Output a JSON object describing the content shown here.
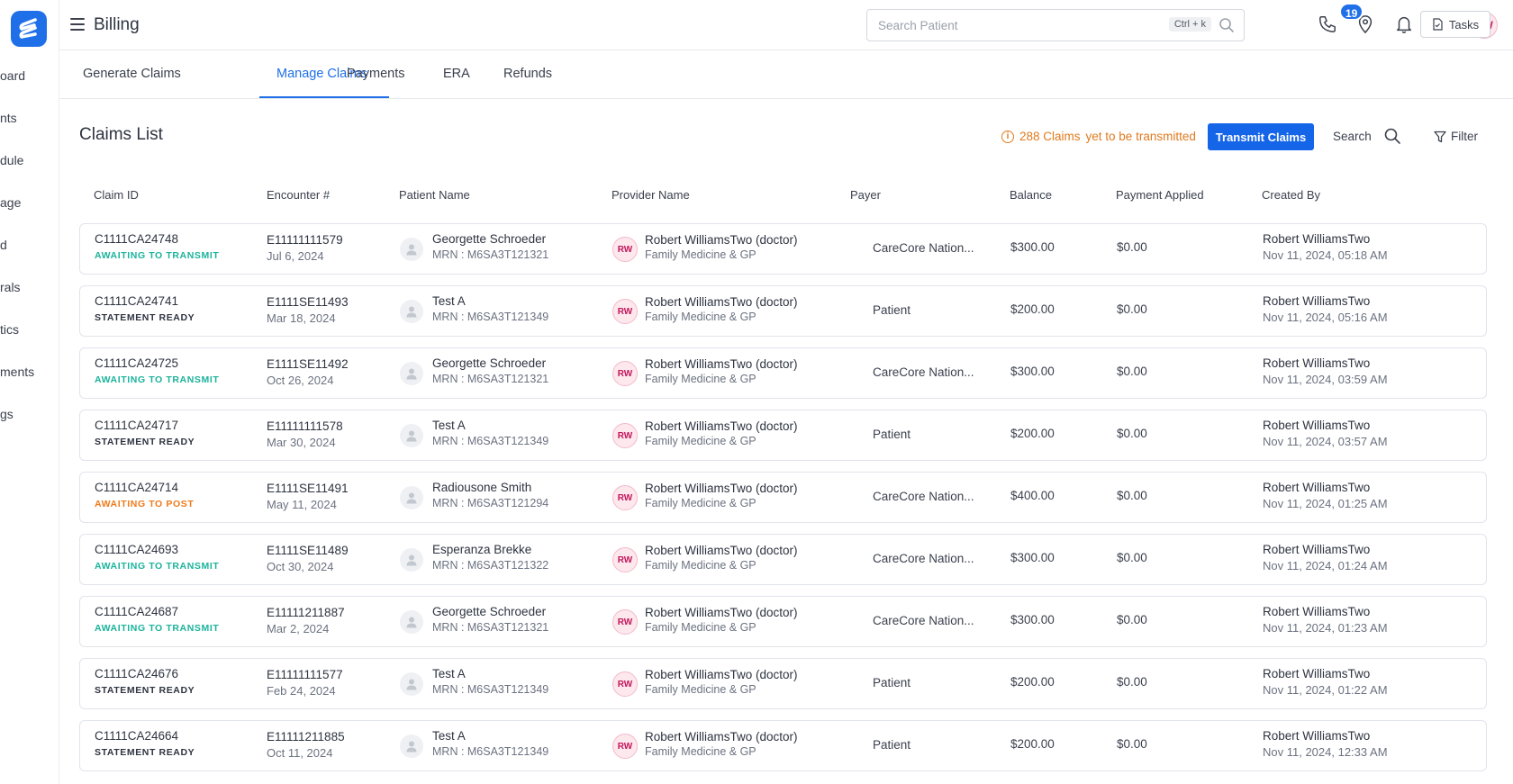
{
  "sidebar": {
    "items": [
      {
        "label": "oard"
      },
      {
        "label": "nts"
      },
      {
        "label": "dule"
      },
      {
        "label": "age"
      },
      {
        "label": "d"
      },
      {
        "label": "rals"
      },
      {
        "label": "tics"
      },
      {
        "label": "ments"
      },
      {
        "label": "gs"
      }
    ]
  },
  "header": {
    "title": "Billing",
    "search_placeholder": "Search Patient",
    "search_shortcut": "Ctrl + k",
    "notification_count": "19",
    "user_initials": "RW",
    "help_label": "?"
  },
  "tabs": [
    {
      "label": "Generate Claims",
      "active": false
    },
    {
      "label": "Manage Claims",
      "active": true
    },
    {
      "label": "Payments",
      "active": false
    },
    {
      "label": "ERA",
      "active": false
    },
    {
      "label": "Refunds",
      "active": false
    }
  ],
  "tasks_label": "Tasks",
  "claims": {
    "title": "Claims List",
    "pending_count": "288 Claims",
    "pending_text": "yet to be transmitted",
    "transmit_label": "Transmit Claims",
    "search_label": "Search",
    "filter_label": "Filter",
    "columns": [
      "Claim ID",
      "Encounter #",
      "Patient Name",
      "Provider Name",
      "Payer",
      "Balance",
      "Payment Applied",
      "Created By"
    ],
    "status_colors": {
      "awaiting_transmit": "#1bb39b",
      "statement_ready": "#2d3340",
      "awaiting_post": "#f07a1a"
    },
    "rows": [
      {
        "claim_id": "C1111CA24748",
        "status": "AWAITING TO TRANSMIT",
        "status_type": "awaiting_transmit",
        "encounter": "E11111111579",
        "encounter_date": "Jul 6, 2024",
        "patient": "Georgette Schroeder",
        "mrn": "MRN : M6SA3T121321",
        "provider_initials": "RW",
        "provider": "Robert WilliamsTwo (doctor)",
        "specialty": "Family Medicine & GP",
        "payer": "CareCore Nation...",
        "balance": "$300.00",
        "payment": "$0.00",
        "created_by": "Robert WilliamsTwo",
        "created_at": "Nov 11, 2024, 05:18 AM"
      },
      {
        "claim_id": "C1111CA24741",
        "status": "STATEMENT READY",
        "status_type": "statement_ready",
        "encounter": "E1111SE11493",
        "encounter_date": "Mar 18, 2024",
        "patient": "Test A",
        "mrn": "MRN : M6SA3T121349",
        "provider_initials": "RW",
        "provider": "Robert WilliamsTwo (doctor)",
        "specialty": "Family Medicine & GP",
        "payer": "Patient",
        "balance": "$200.00",
        "payment": "$0.00",
        "created_by": "Robert WilliamsTwo",
        "created_at": "Nov 11, 2024, 05:16 AM"
      },
      {
        "claim_id": "C1111CA24725",
        "status": "AWAITING TO TRANSMIT",
        "status_type": "awaiting_transmit",
        "encounter": "E1111SE11492",
        "encounter_date": "Oct 26, 2024",
        "patient": "Georgette Schroeder",
        "mrn": "MRN : M6SA3T121321",
        "provider_initials": "RW",
        "provider": "Robert WilliamsTwo (doctor)",
        "specialty": "Family Medicine & GP",
        "payer": "CareCore Nation...",
        "balance": "$300.00",
        "payment": "$0.00",
        "created_by": "Robert WilliamsTwo",
        "created_at": "Nov 11, 2024, 03:59 AM"
      },
      {
        "claim_id": "C1111CA24717",
        "status": "STATEMENT READY",
        "status_type": "statement_ready",
        "encounter": "E11111111578",
        "encounter_date": "Mar 30, 2024",
        "patient": "Test A",
        "mrn": "MRN : M6SA3T121349",
        "provider_initials": "RW",
        "provider": "Robert WilliamsTwo (doctor)",
        "specialty": "Family Medicine & GP",
        "payer": "Patient",
        "balance": "$200.00",
        "payment": "$0.00",
        "created_by": "Robert WilliamsTwo",
        "created_at": "Nov 11, 2024, 03:57 AM"
      },
      {
        "claim_id": "C1111CA24714",
        "status": "AWAITING TO POST",
        "status_type": "awaiting_post",
        "encounter": "E1111SE11491",
        "encounter_date": "May 11, 2024",
        "patient": "Radiousone Smith",
        "mrn": "MRN : M6SA3T121294",
        "provider_initials": "RW",
        "provider": "Robert WilliamsTwo (doctor)",
        "specialty": "Family Medicine & GP",
        "payer": "CareCore Nation...",
        "balance": "$400.00",
        "payment": "$0.00",
        "created_by": "Robert WilliamsTwo",
        "created_at": "Nov 11, 2024, 01:25 AM"
      },
      {
        "claim_id": "C1111CA24693",
        "status": "AWAITING TO TRANSMIT",
        "status_type": "awaiting_transmit",
        "encounter": "E1111SE11489",
        "encounter_date": "Oct 30, 2024",
        "patient": "Esperanza Brekke",
        "mrn": "MRN : M6SA3T121322",
        "provider_initials": "RW",
        "provider": "Robert WilliamsTwo (doctor)",
        "specialty": "Family Medicine & GP",
        "payer": "CareCore Nation...",
        "balance": "$300.00",
        "payment": "$0.00",
        "created_by": "Robert WilliamsTwo",
        "created_at": "Nov 11, 2024, 01:24 AM"
      },
      {
        "claim_id": "C1111CA24687",
        "status": "AWAITING TO TRANSMIT",
        "status_type": "awaiting_transmit",
        "encounter": "E11111211887",
        "encounter_date": "Mar 2, 2024",
        "patient": "Georgette Schroeder",
        "mrn": "MRN : M6SA3T121321",
        "provider_initials": "RW",
        "provider": "Robert WilliamsTwo (doctor)",
        "specialty": "Family Medicine & GP",
        "payer": "CareCore Nation...",
        "balance": "$300.00",
        "payment": "$0.00",
        "created_by": "Robert WilliamsTwo",
        "created_at": "Nov 11, 2024, 01:23 AM"
      },
      {
        "claim_id": "C1111CA24676",
        "status": "STATEMENT READY",
        "status_type": "statement_ready",
        "encounter": "E11111111577",
        "encounter_date": "Feb 24, 2024",
        "patient": "Test A",
        "mrn": "MRN : M6SA3T121349",
        "provider_initials": "RW",
        "provider": "Robert WilliamsTwo (doctor)",
        "specialty": "Family Medicine & GP",
        "payer": "Patient",
        "balance": "$200.00",
        "payment": "$0.00",
        "created_by": "Robert WilliamsTwo",
        "created_at": "Nov 11, 2024, 01:22 AM"
      },
      {
        "claim_id": "C1111CA24664",
        "status": "STATEMENT READY",
        "status_type": "statement_ready",
        "encounter": "E11111211885",
        "encounter_date": "Oct 11, 2024",
        "patient": "Test A",
        "mrn": "MRN : M6SA3T121349",
        "provider_initials": "RW",
        "provider": "Robert WilliamsTwo (doctor)",
        "specialty": "Family Medicine & GP",
        "payer": "Patient",
        "balance": "$200.00",
        "payment": "$0.00",
        "created_by": "Robert WilliamsTwo",
        "created_at": "Nov 11, 2024, 12:33 AM"
      }
    ]
  }
}
